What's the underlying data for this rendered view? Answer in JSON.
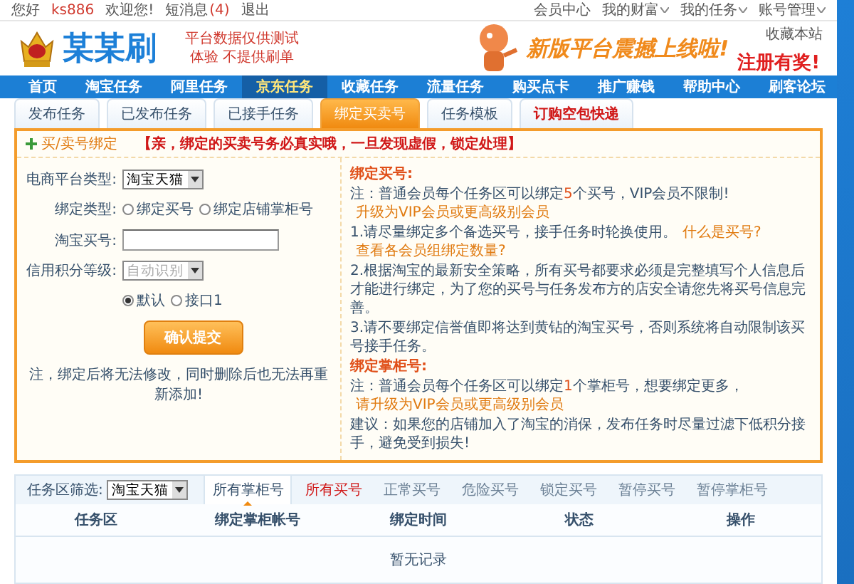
{
  "top_bar": {
    "greeting": "您好",
    "username": "ks886",
    "welcome": "欢迎您!",
    "messages": "短消息",
    "message_count": "(4)",
    "logout": "退出",
    "links": [
      {
        "label": "会员中心",
        "has_menu": false
      },
      {
        "label": "我的财富",
        "has_menu": true
      },
      {
        "label": "我的任务",
        "has_menu": true
      },
      {
        "label": "账号管理",
        "has_menu": true
      }
    ],
    "bookmark": "收藏本站"
  },
  "header": {
    "logo_text": "某某刷",
    "tagline": [
      "平台数据仅供测试",
      "体验  不提供刷单"
    ],
    "banner_headline": "新版平台震撼上线啦!",
    "banner_sub": "注册有奖!"
  },
  "nav": [
    {
      "label": "首页",
      "selected": false
    },
    {
      "label": "淘宝任务",
      "selected": false
    },
    {
      "label": "阿里任务",
      "selected": false
    },
    {
      "label": "京东任务",
      "selected": true
    },
    {
      "label": "收藏任务",
      "selected": false
    },
    {
      "label": "流量任务",
      "selected": false
    },
    {
      "label": "购买点卡",
      "selected": false
    },
    {
      "label": "推广赚钱",
      "selected": false
    },
    {
      "label": "帮助中心",
      "selected": false
    },
    {
      "label": "刷客论坛",
      "selected": false
    }
  ],
  "tabs": [
    {
      "label": "发布任务",
      "selected": false,
      "kind": "normal"
    },
    {
      "label": "已发布任务",
      "selected": false,
      "kind": "normal"
    },
    {
      "label": "已接手任务",
      "selected": false,
      "kind": "normal"
    },
    {
      "label": "绑定买卖号",
      "selected": true,
      "kind": "normal"
    },
    {
      "label": "任务模板",
      "selected": false,
      "kind": "normal"
    },
    {
      "label": "订购空包快递",
      "selected": false,
      "kind": "promo"
    }
  ],
  "panel": {
    "title": "买/卖号绑定",
    "notice": "【亲，绑定的买卖号务必真实哦，一旦发现虚假，锁定处理】",
    "form": {
      "platform_label": "电商平台类型:",
      "platform_value": "淘宝天猫",
      "bind_type_label": "绑定类型:",
      "bind_options": [
        {
          "label": "绑定买号",
          "selected": false
        },
        {
          "label": "绑定店铺掌柜号",
          "selected": false
        }
      ],
      "account_label": "淘宝买号:",
      "credit_label": "信用积分等级:",
      "credit_value": "自动识别",
      "credit_disabled": true,
      "channel_options": [
        {
          "label": "默认",
          "selected": true
        },
        {
          "label": "接口1",
          "selected": false
        }
      ],
      "submit": "确认提交",
      "note": "注，绑定后将无法修改，同时删除后也无法再重新添加!"
    },
    "info": [
      {
        "kind": "heading",
        "segments": [
          {
            "kind": "plain",
            "text": "绑定买号:"
          }
        ]
      },
      {
        "kind": "para",
        "segments": [
          {
            "kind": "plain",
            "text": "注：普通会员每个任务区可以绑定"
          },
          {
            "kind": "highlight",
            "text": "5"
          },
          {
            "kind": "plain",
            "text": "个买号，VIP会员不限制!"
          },
          {
            "kind": "link",
            "text": "升级为VIP会员或更高级别会员"
          }
        ]
      },
      {
        "kind": "para",
        "segments": [
          {
            "kind": "plain",
            "text": "1.请尽量绑定多个备选买号，接手任务时轮换使用。"
          },
          {
            "kind": "link",
            "text": "什么是买号?"
          },
          {
            "kind": "link",
            "text": "查看各会员组绑定数量?"
          }
        ]
      },
      {
        "kind": "para",
        "segments": [
          {
            "kind": "plain",
            "text": "2.根据淘宝的最新安全策略，所有买号都要求必须是完整填写个人信息后才能进行绑定，为了您的买号与任务发布方的店安全请您先将买号信息完善。"
          }
        ]
      },
      {
        "kind": "para",
        "segments": [
          {
            "kind": "plain",
            "text": "3.请不要绑定信誉值即将达到黄钻的淘宝买号，否则系统将自动限制该买号接手任务。"
          }
        ]
      },
      {
        "kind": "heading",
        "segments": [
          {
            "kind": "plain",
            "text": "绑定掌柜号:"
          }
        ]
      },
      {
        "kind": "para",
        "segments": [
          {
            "kind": "plain",
            "text": "注：普通会员每个任务区可以绑定"
          },
          {
            "kind": "highlight",
            "text": "1"
          },
          {
            "kind": "plain",
            "text": "个掌柜号，想要绑定更多，"
          },
          {
            "kind": "link",
            "text": "请升级为VIP会员或更高级别会员"
          }
        ]
      },
      {
        "kind": "para",
        "segments": [
          {
            "kind": "plain",
            "text": "建议：如果您的店铺加入了淘宝的消保，发布任务时尽量过滤下低积分接手，避免受到损失!"
          }
        ]
      }
    ]
  },
  "list": {
    "filter_label": "任务区筛选:",
    "filter_value": "淘宝天猫",
    "tabs": [
      {
        "label": "所有掌柜号",
        "selected": true,
        "kind": "normal"
      },
      {
        "label": "所有买号",
        "selected": false,
        "kind": "promo"
      },
      {
        "label": "正常买号",
        "selected": false,
        "kind": "normal"
      },
      {
        "label": "危险买号",
        "selected": false,
        "kind": "normal"
      },
      {
        "label": "锁定买号",
        "selected": false,
        "kind": "normal"
      },
      {
        "label": "暂停买号",
        "selected": false,
        "kind": "normal"
      },
      {
        "label": "暂停掌柜号",
        "selected": false,
        "kind": "normal"
      }
    ],
    "columns": [
      "任务区",
      "绑定掌柜帐号",
      "绑定时间",
      "状态",
      "操作"
    ],
    "empty": "暂无记录"
  }
}
